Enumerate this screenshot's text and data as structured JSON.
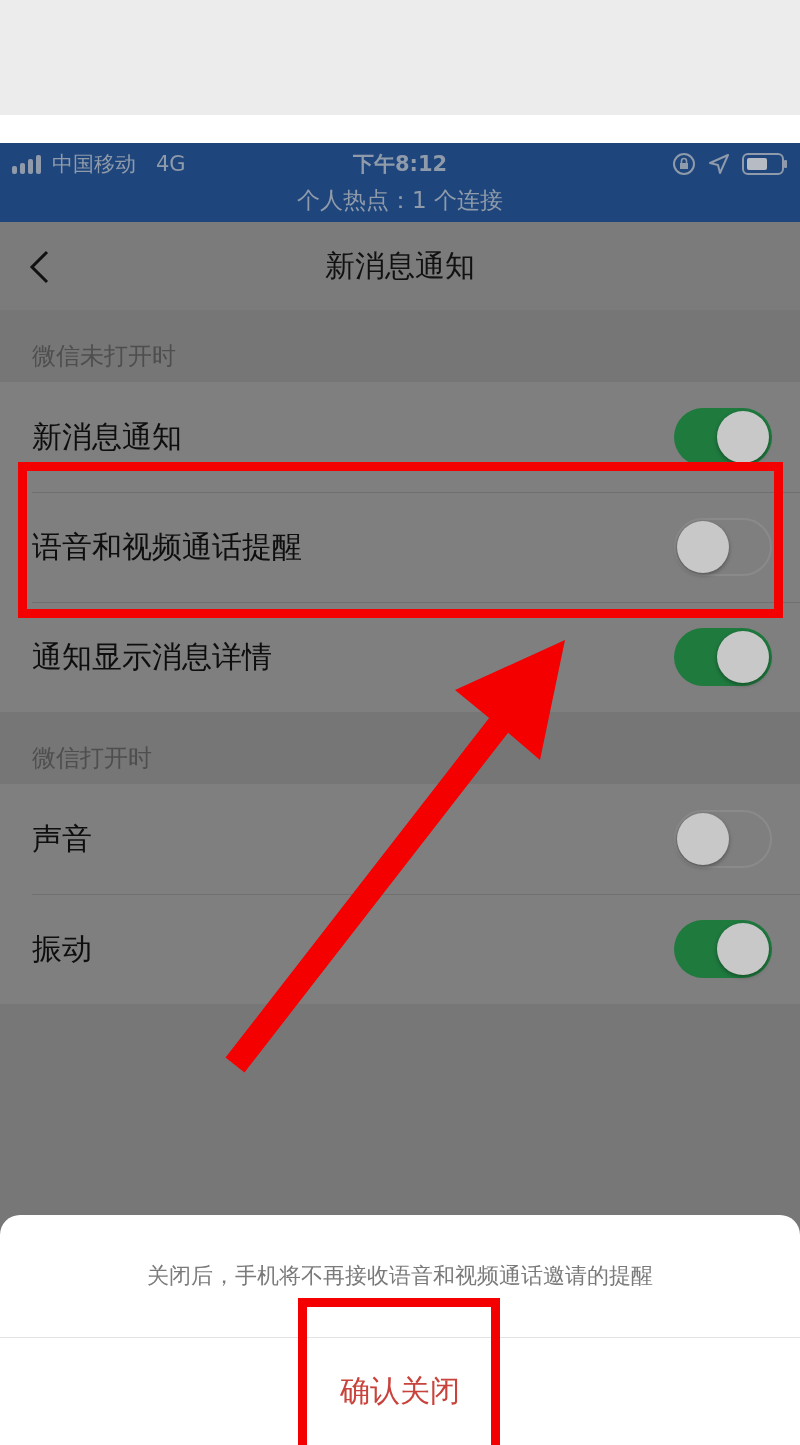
{
  "status_bar": {
    "carrier": "中国移动",
    "network": "4G",
    "time": "下午8:12",
    "hotspot": "个人热点：1 个连接"
  },
  "nav": {
    "title": "新消息通知"
  },
  "sections": [
    {
      "header": "微信未打开时",
      "rows": [
        {
          "label": "新消息通知",
          "on": true
        },
        {
          "label": "语音和视频通话提醒",
          "on": false
        },
        {
          "label": "通知显示消息详情",
          "on": true
        }
      ]
    },
    {
      "header": "微信打开时",
      "rows": [
        {
          "label": "声音",
          "on": false
        },
        {
          "label": "振动",
          "on": true
        }
      ]
    }
  ],
  "sheet": {
    "message": "关闭后，手机将不再接收语音和视频通话邀请的提醒",
    "confirm": "确认关闭"
  }
}
